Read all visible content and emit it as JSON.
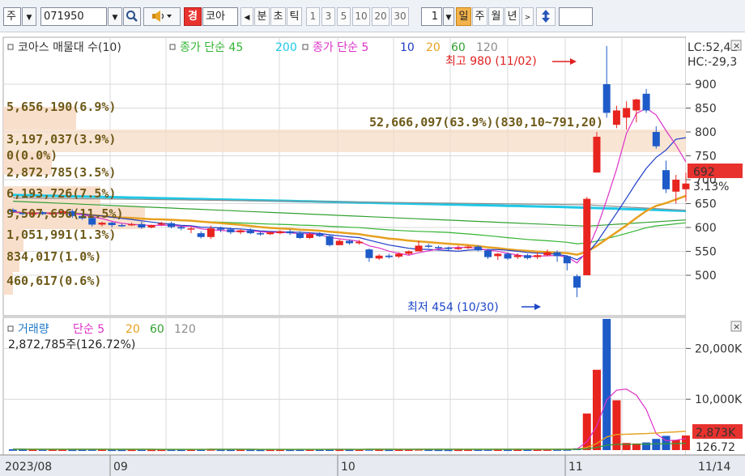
{
  "toolbar": {
    "market_type": "주",
    "code": "071950",
    "warning": "경",
    "stock_name": "코아",
    "tick_labels": [
      "분",
      "초",
      "틱"
    ],
    "intervals": [
      "1",
      "3",
      "5",
      "10",
      "20",
      "30"
    ],
    "interval_value": "1",
    "periods": [
      "일",
      "주",
      "월",
      "년"
    ],
    "active_period": "일"
  },
  "price_panel": {
    "legend": [
      {
        "text": "코아스 매물대 수(10)",
        "color": "#333333"
      },
      {
        "text": "종가 단순 45",
        "color": "#32b432"
      },
      {
        "text": "200",
        "color": "#1ec8e6"
      },
      {
        "text": "종가 단순 5",
        "color": "#dc32c8"
      },
      {
        "text": "10",
        "color": "#1e3cc8"
      },
      {
        "text": "20",
        "color": "#e6a020"
      },
      {
        "text": "60",
        "color": "#32a032"
      },
      {
        "text": "120",
        "color": "#8c8c8c"
      }
    ],
    "lc_label": "LC:52,42",
    "hc_label": "HC:-29,3",
    "current_price": "692",
    "current_change": "3.13%",
    "high_annotation": "최고 980 (11/02)",
    "low_annotation": "최저 454 (10/30)",
    "volume_profile": [
      {
        "label": "5,656,190(6.9%)"
      },
      {
        "label": "52,666,097(63.9%)(830,10~791,20)"
      },
      {
        "label": "3,197,037(3.9%)"
      },
      {
        "label": "0(0.0%)"
      },
      {
        "label": "2,872,785(3.5%)"
      },
      {
        "label": "6,193,726(7.5%)"
      },
      {
        "label": "9,507,696(11.5%)"
      },
      {
        "label": "1,051,991(1.3%)"
      },
      {
        "label": "834,017(1.0%)"
      },
      {
        "label": "460,617(0.6%)"
      }
    ]
  },
  "volume_panel": {
    "legend": [
      {
        "text": "거래량",
        "color": "#1e78c8"
      },
      {
        "text": "단순 5",
        "color": "#dc32c8"
      },
      {
        "text": "20",
        "color": "#e6a020"
      },
      {
        "text": "60",
        "color": "#32a032"
      },
      {
        "text": "120",
        "color": "#8c8c8c"
      }
    ],
    "info": "2,872,785주(126.72%)",
    "current_volume": "2,873K",
    "current_ratio": "126.72"
  },
  "x_axis_labels": [
    {
      "text": "2023/08"
    },
    {
      "text": "09"
    },
    {
      "text": "10"
    },
    {
      "text": "11"
    },
    {
      "text": "11/14"
    }
  ],
  "chart_data": {
    "type": "candlestick",
    "price_axis": {
      "ticks": [
        500,
        550,
        600,
        650,
        700,
        750,
        800,
        850,
        900
      ],
      "ylim": [
        440,
        1000
      ]
    },
    "volume_axis": {
      "ticks": [
        "10,000K",
        "20,000K"
      ],
      "ylim": [
        0,
        27000
      ]
    },
    "candles": [
      {
        "o": 637,
        "h": 640,
        "c": 633,
        "l": 630
      },
      {
        "o": 631,
        "h": 634,
        "c": 628,
        "l": 626
      },
      {
        "o": 627,
        "h": 633,
        "c": 630,
        "l": 624
      },
      {
        "o": 632,
        "h": 634,
        "c": 628,
        "l": 626
      },
      {
        "o": 628,
        "h": 632,
        "c": 630,
        "l": 625
      },
      {
        "o": 630,
        "h": 636,
        "c": 634,
        "l": 628
      },
      {
        "o": 634,
        "h": 638,
        "c": 624,
        "l": 620
      },
      {
        "o": 624,
        "h": 628,
        "c": 619,
        "l": 616
      },
      {
        "o": 620,
        "h": 622,
        "c": 606,
        "l": 602
      },
      {
        "o": 606,
        "h": 612,
        "c": 610,
        "l": 602
      },
      {
        "o": 610,
        "h": 612,
        "c": 605,
        "l": 600
      },
      {
        "o": 605,
        "h": 608,
        "c": 604,
        "l": 601
      },
      {
        "o": 605,
        "h": 610,
        "c": 607,
        "l": 603
      },
      {
        "o": 607,
        "h": 612,
        "c": 600,
        "l": 597
      },
      {
        "o": 600,
        "h": 606,
        "c": 605,
        "l": 598
      },
      {
        "o": 606,
        "h": 612,
        "c": 609,
        "l": 603
      },
      {
        "o": 609,
        "h": 612,
        "c": 601,
        "l": 598
      },
      {
        "o": 601,
        "h": 604,
        "c": 598,
        "l": 594
      },
      {
        "o": 596,
        "h": 602,
        "c": 598,
        "l": 588
      },
      {
        "o": 588,
        "h": 592,
        "c": 580,
        "l": 577
      },
      {
        "o": 580,
        "h": 604,
        "c": 598,
        "l": 576
      },
      {
        "o": 598,
        "h": 602,
        "c": 596,
        "l": 590
      },
      {
        "o": 596,
        "h": 600,
        "c": 590,
        "l": 586
      },
      {
        "o": 590,
        "h": 597,
        "c": 594,
        "l": 586
      },
      {
        "o": 594,
        "h": 598,
        "c": 588,
        "l": 586
      },
      {
        "o": 588,
        "h": 592,
        "c": 586,
        "l": 583
      },
      {
        "o": 586,
        "h": 592,
        "c": 590,
        "l": 584
      },
      {
        "o": 588,
        "h": 594,
        "c": 592,
        "l": 586
      },
      {
        "o": 592,
        "h": 596,
        "c": 588,
        "l": 584
      },
      {
        "o": 588,
        "h": 592,
        "c": 578,
        "l": 576
      },
      {
        "o": 578,
        "h": 590,
        "c": 586,
        "l": 576
      },
      {
        "o": 586,
        "h": 590,
        "c": 582,
        "l": 580
      },
      {
        "o": 582,
        "h": 585,
        "c": 563,
        "l": 560
      },
      {
        "o": 563,
        "h": 575,
        "c": 572,
        "l": 563
      },
      {
        "o": 572,
        "h": 575,
        "c": 567,
        "l": 564
      },
      {
        "o": 567,
        "h": 574,
        "c": 570,
        "l": 564
      },
      {
        "o": 554,
        "h": 556,
        "c": 536,
        "l": 528
      },
      {
        "o": 535,
        "h": 544,
        "c": 541,
        "l": 532
      },
      {
        "o": 541,
        "h": 545,
        "c": 538,
        "l": 535
      },
      {
        "o": 539,
        "h": 548,
        "c": 545,
        "l": 536
      },
      {
        "o": 545,
        "h": 552,
        "c": 550,
        "l": 542
      },
      {
        "o": 550,
        "h": 572,
        "c": 562,
        "l": 550
      },
      {
        "o": 562,
        "h": 566,
        "c": 560,
        "l": 557
      },
      {
        "o": 559,
        "h": 562,
        "c": 558,
        "l": 556
      },
      {
        "o": 558,
        "h": 560,
        "c": 555,
        "l": 552
      },
      {
        "o": 555,
        "h": 562,
        "c": 557,
        "l": 553
      },
      {
        "o": 557,
        "h": 562,
        "c": 560,
        "l": 555
      },
      {
        "o": 560,
        "h": 563,
        "c": 552,
        "l": 550
      },
      {
        "o": 552,
        "h": 555,
        "c": 538,
        "l": 534
      },
      {
        "o": 540,
        "h": 547,
        "c": 545,
        "l": 532
      },
      {
        "o": 545,
        "h": 548,
        "c": 535,
        "l": 532
      },
      {
        "o": 538,
        "h": 546,
        "c": 542,
        "l": 534
      },
      {
        "o": 542,
        "h": 545,
        "c": 536,
        "l": 533
      },
      {
        "o": 538,
        "h": 548,
        "c": 542,
        "l": 534
      },
      {
        "o": 542,
        "h": 554,
        "c": 548,
        "l": 540
      },
      {
        "o": 548,
        "h": 552,
        "c": 540,
        "l": 528
      },
      {
        "o": 540,
        "h": 542,
        "c": 525,
        "l": 510
      },
      {
        "o": 498,
        "h": 502,
        "c": 474,
        "l": 454
      },
      {
        "o": 500,
        "h": 664,
        "c": 660,
        "l": 500
      },
      {
        "o": 715,
        "h": 800,
        "c": 790,
        "l": 715
      },
      {
        "o": 900,
        "h": 980,
        "c": 840,
        "l": 830
      },
      {
        "o": 815,
        "h": 855,
        "c": 845,
        "l": 808
      },
      {
        "o": 830,
        "h": 864,
        "c": 850,
        "l": 805
      },
      {
        "o": 845,
        "h": 870,
        "c": 868,
        "l": 820
      },
      {
        "o": 880,
        "h": 890,
        "c": 845,
        "l": 840
      },
      {
        "o": 800,
        "h": 812,
        "c": 770,
        "l": 765
      },
      {
        "o": 720,
        "h": 740,
        "c": 680,
        "l": 672
      },
      {
        "o": 675,
        "h": 710,
        "c": 700,
        "l": 650
      },
      {
        "o": 680,
        "h": 715,
        "c": 692,
        "l": 655
      }
    ],
    "volume": [
      180,
      160,
      150,
      170,
      160,
      150,
      140,
      150,
      170,
      150,
      140,
      130,
      140,
      150,
      130,
      140,
      150,
      140,
      150,
      160,
      200,
      150,
      140,
      150,
      140,
      130,
      140,
      150,
      140,
      150,
      160,
      150,
      160,
      150,
      140,
      150,
      200,
      150,
      140,
      150,
      160,
      220,
      150,
      140,
      130,
      140,
      150,
      160,
      170,
      160,
      150,
      160,
      150,
      160,
      170,
      180,
      200,
      350,
      7200,
      15800,
      25800,
      9800,
      1400,
      1300,
      1500,
      2200,
      2800,
      2000,
      2873
    ]
  }
}
